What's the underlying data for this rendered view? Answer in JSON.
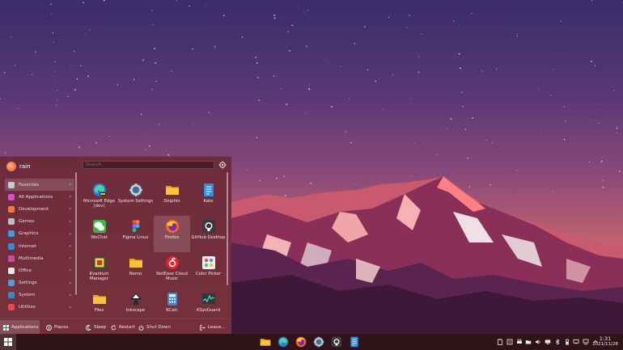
{
  "user": {
    "name": "rain"
  },
  "search": {
    "placeholder": "Search..."
  },
  "categories": [
    {
      "label": "Favorites",
      "color": "#c0ccd8"
    },
    {
      "label": "All Applications",
      "color": "#d84fd0"
    },
    {
      "label": "Development",
      "color": "#f07a3a"
    },
    {
      "label": "Games",
      "color": "#b8c0c8"
    },
    {
      "label": "Graphics",
      "color": "#3a9be8"
    },
    {
      "label": "Internet",
      "color": "#2f8fe0"
    },
    {
      "label": "Multimedia",
      "color": "#d04a9a"
    },
    {
      "label": "Office",
      "color": "#e8e8e8"
    },
    {
      "label": "Settings",
      "color": "#4a9fd8"
    },
    {
      "label": "System",
      "color": "#3d86c8"
    },
    {
      "label": "Utilities",
      "color": "#e84a4a"
    }
  ],
  "apps": [
    {
      "label": "Microsoft Edge (dev)",
      "icon": "edge-dev-icon"
    },
    {
      "label": "System Settings",
      "icon": "system-settings-icon"
    },
    {
      "label": "Dolphin",
      "icon": "folder-icon"
    },
    {
      "label": "Kate",
      "icon": "kate-icon"
    },
    {
      "label": "WeChat",
      "icon": "wechat-icon"
    },
    {
      "label": "Figma Linux",
      "icon": "figma-icon"
    },
    {
      "label": "Firefox",
      "icon": "firefox-icon"
    },
    {
      "label": "GitHub Desktop",
      "icon": "github-icon"
    },
    {
      "label": "Kvantum Manager",
      "icon": "kvantum-icon"
    },
    {
      "label": "Nemo",
      "icon": "folder-icon"
    },
    {
      "label": "NetEase Cloud Music",
      "icon": "netease-music-icon"
    },
    {
      "label": "Color Picker",
      "icon": "color-picker-icon"
    },
    {
      "label": "Files",
      "icon": "folder-icon"
    },
    {
      "label": "Inkscape",
      "icon": "inkscape-icon"
    },
    {
      "label": "KCalc",
      "icon": "kcalc-icon"
    },
    {
      "label": "KSysGuard",
      "icon": "ksysguard-icon"
    }
  ],
  "footer": {
    "applications_label": "Applications",
    "places_label": "Places",
    "sleep_label": "Sleep",
    "restart_label": "Restart",
    "shutdown_label": "Shut Down",
    "leave_label": "Leave..."
  },
  "taskbar": {
    "pinned": [
      "folder-icon",
      "edge-icon",
      "firefox-icon",
      "system-settings-icon",
      "github-icon",
      "kate-icon"
    ],
    "tray": [
      "clipboard-icon",
      "notes-icon",
      "printer-icon",
      "folder-sync-icon",
      "volume-icon",
      "monitor-icon",
      "bluetooth-icon",
      "battery-icon",
      "display-icon",
      "network-icon",
      "expand-tray-icon"
    ]
  },
  "clock": {
    "time": "1:31",
    "date": "2021/11/28"
  },
  "colors": {
    "panel": "#6c2a38",
    "taskbar": "#280e16"
  }
}
